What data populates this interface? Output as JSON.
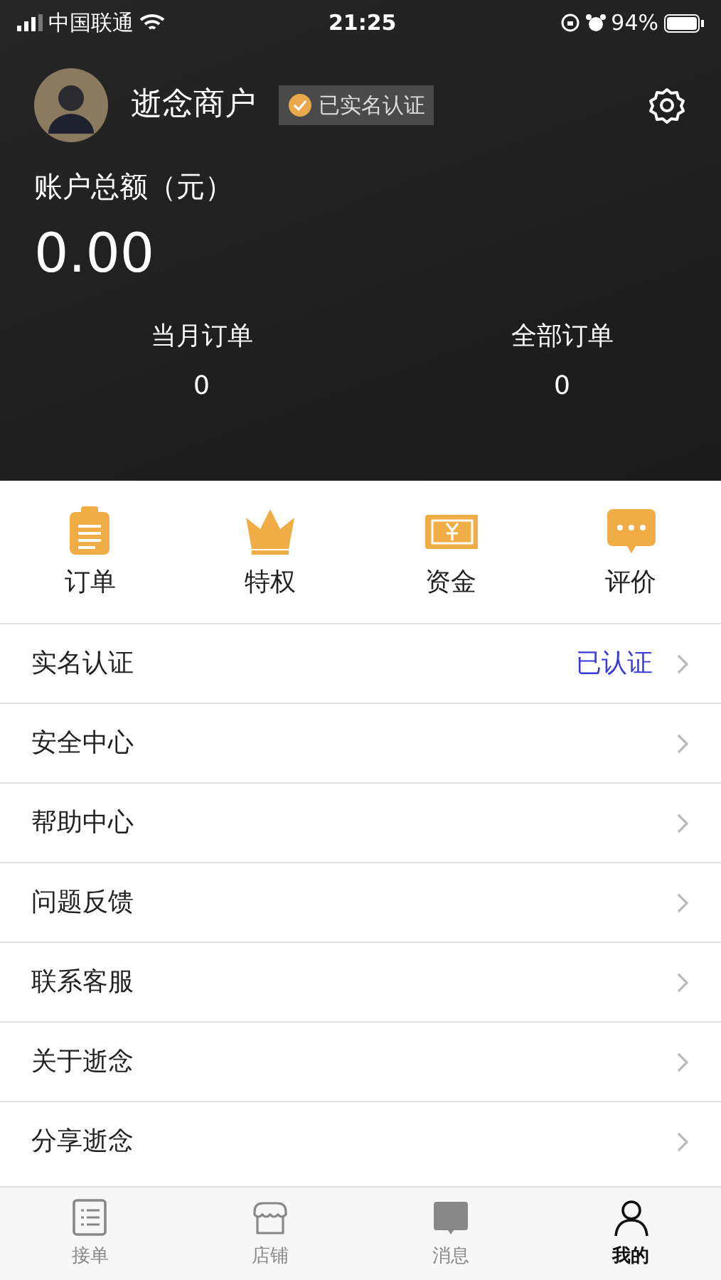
{
  "status_bar": {
    "carrier": "中国联通",
    "time": "21:25",
    "battery": "94%"
  },
  "profile": {
    "name": "逝念商户",
    "verified_badge": "已实名认证"
  },
  "balance": {
    "label": "账户总额（元）",
    "amount": "0.00"
  },
  "stats": [
    {
      "label": "当月订单",
      "value": "0"
    },
    {
      "label": "全部订单",
      "value": "0"
    }
  ],
  "shortcuts": [
    {
      "kind": "order",
      "label": "订单"
    },
    {
      "kind": "vip",
      "label": "特权"
    },
    {
      "kind": "money",
      "label": "资金"
    },
    {
      "kind": "comment",
      "label": "评价"
    }
  ],
  "menu": [
    {
      "label": "实名认证",
      "value": "已认证"
    },
    {
      "label": "安全中心"
    },
    {
      "label": "帮助中心"
    },
    {
      "label": "问题反馈"
    },
    {
      "label": "联系客服"
    },
    {
      "label": "关于逝念"
    },
    {
      "label": "分享逝念"
    }
  ],
  "tab_bar": [
    {
      "kind": "list",
      "label": "接单",
      "selected": false
    },
    {
      "kind": "shop",
      "label": "店铺",
      "selected": false
    },
    {
      "kind": "message",
      "label": "消息",
      "selected": false
    },
    {
      "kind": "person",
      "label": "我的",
      "selected": true
    }
  ]
}
